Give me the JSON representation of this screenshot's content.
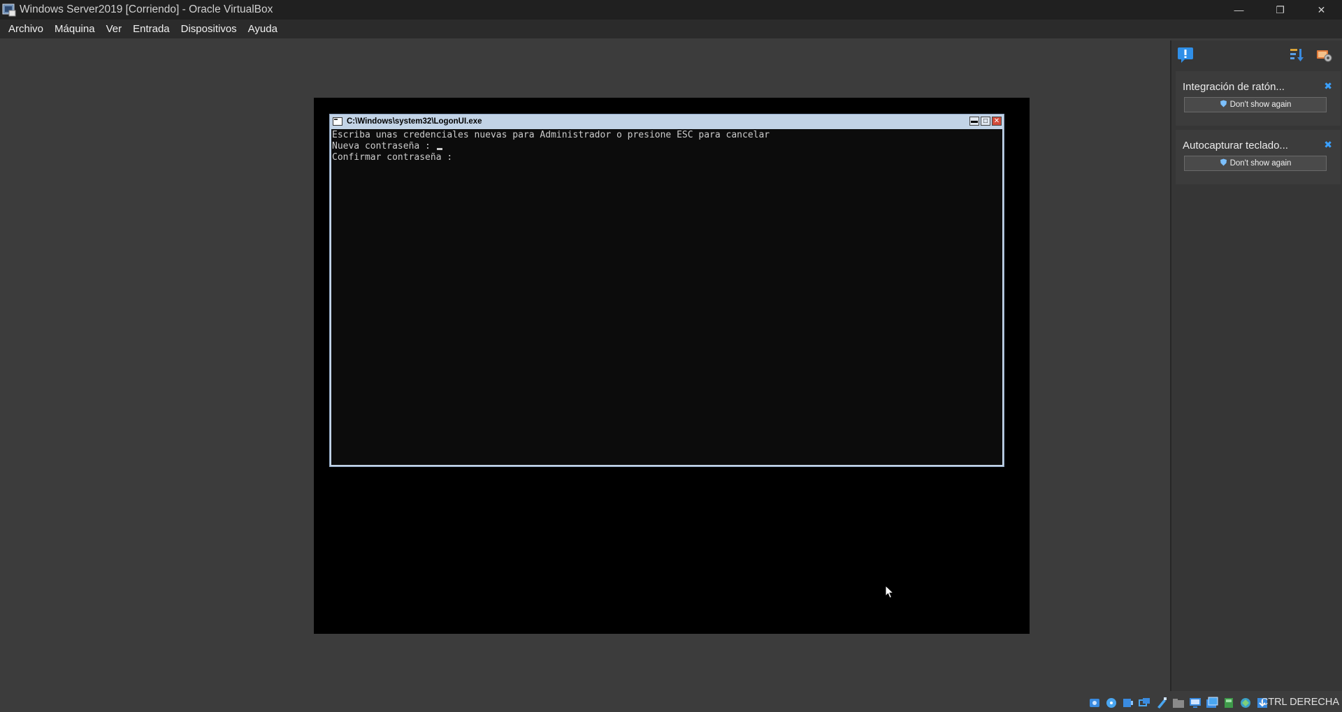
{
  "window": {
    "title": "Windows Server2019 [Corriendo] - Oracle VirtualBox",
    "controls": {
      "minimize": "—",
      "restore": "❐",
      "close": "✕"
    }
  },
  "menubar": {
    "items": [
      "Archivo",
      "Máquina",
      "Ver",
      "Entrada",
      "Dispositivos",
      "Ayuda"
    ]
  },
  "guest": {
    "console_title": "C:\\Windows\\system32\\LogonUI.exe",
    "console_controls": {
      "minimize": "▬",
      "maximize": "□",
      "close": "✕"
    },
    "lines": [
      "Escriba unas credenciales nuevas para Administrador o presione ESC para cancelar",
      "Nueva contraseña : ",
      "Confirmar contraseña :"
    ]
  },
  "side_panel": {
    "icons": [
      "message-icon",
      "sort-icon",
      "settings-icon"
    ],
    "notifications": [
      {
        "text": "Integración de ratón...",
        "button": "Don't show again"
      },
      {
        "text": "Autocapturar teclado...",
        "button": "Don't show again"
      }
    ]
  },
  "statusbar": {
    "icons": [
      "hard-disk-icon",
      "optical-drive-icon",
      "audio-icon",
      "network-icon",
      "usb-icon",
      "shared-folders-icon",
      "display-icon",
      "video-capture-icon",
      "recording-icon",
      "cpu-icon",
      "mouse-integration-icon",
      "keyboard-icon"
    ],
    "host_key": "CTRL DERECHA"
  },
  "colors": {
    "title_bar": "#202020",
    "menu_bar": "#2b2b2b",
    "background": "#3c3c3c",
    "console_frame": "#c2d3e6",
    "accent": "#3aa0ff"
  }
}
